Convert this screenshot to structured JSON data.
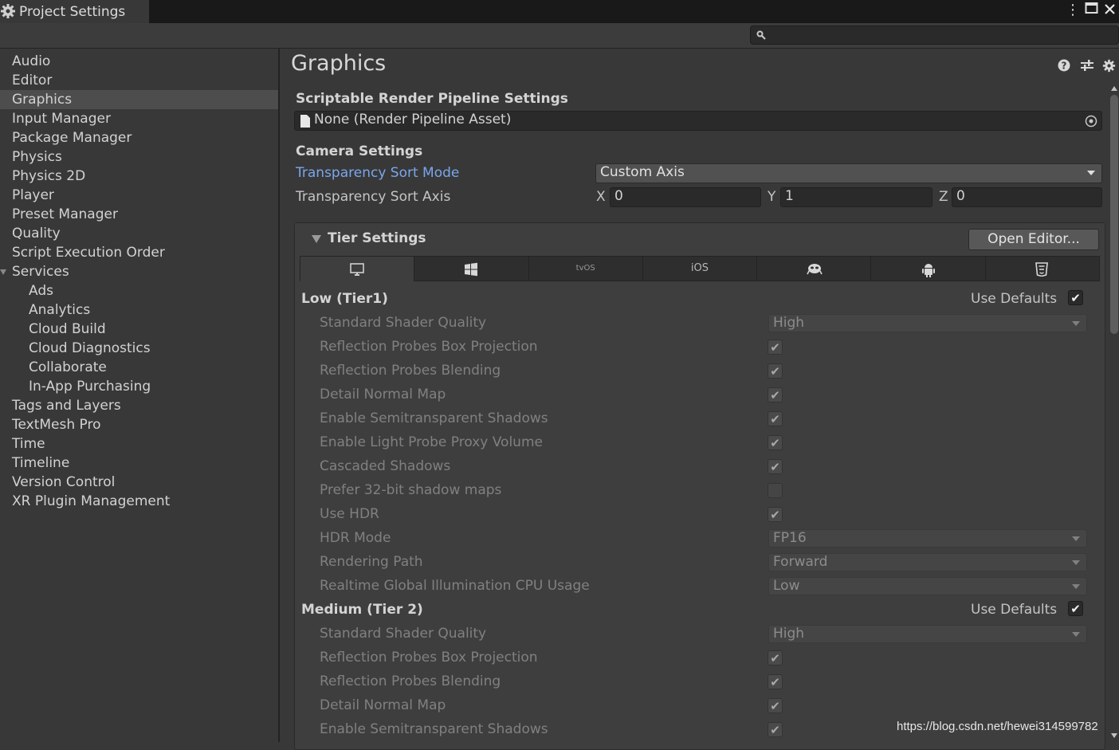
{
  "window": {
    "tab_title": "Project Settings"
  },
  "search": {
    "placeholder": ""
  },
  "sidebar": {
    "items": [
      {
        "label": "Audio",
        "indent": 0
      },
      {
        "label": "Editor",
        "indent": 0
      },
      {
        "label": "Graphics",
        "indent": 0,
        "selected": true
      },
      {
        "label": "Input Manager",
        "indent": 0
      },
      {
        "label": "Package Manager",
        "indent": 0
      },
      {
        "label": "Physics",
        "indent": 0
      },
      {
        "label": "Physics 2D",
        "indent": 0
      },
      {
        "label": "Player",
        "indent": 0
      },
      {
        "label": "Preset Manager",
        "indent": 0
      },
      {
        "label": "Quality",
        "indent": 0
      },
      {
        "label": "Script Execution Order",
        "indent": 0
      },
      {
        "label": "Services",
        "indent": 0,
        "foldout": true
      },
      {
        "label": "Ads",
        "indent": 1
      },
      {
        "label": "Analytics",
        "indent": 1
      },
      {
        "label": "Cloud Build",
        "indent": 1
      },
      {
        "label": "Cloud Diagnostics",
        "indent": 1
      },
      {
        "label": "Collaborate",
        "indent": 1
      },
      {
        "label": "In-App Purchasing",
        "indent": 1
      },
      {
        "label": "Tags and Layers",
        "indent": 0
      },
      {
        "label": "TextMesh Pro",
        "indent": 0
      },
      {
        "label": "Time",
        "indent": 0
      },
      {
        "label": "Timeline",
        "indent": 0
      },
      {
        "label": "Version Control",
        "indent": 0
      },
      {
        "label": "XR Plugin Management",
        "indent": 0
      }
    ]
  },
  "main": {
    "title": "Graphics",
    "srp": {
      "section": "Scriptable Render Pipeline Settings",
      "value": "None (Render Pipeline Asset)"
    },
    "camera": {
      "section": "Camera Settings",
      "sort_mode_label": "Transparency Sort Mode",
      "sort_mode_value": "Custom Axis",
      "sort_axis_label": "Transparency Sort Axis",
      "axis": {
        "x_label": "X",
        "x": "0",
        "y_label": "Y",
        "y": "1",
        "z_label": "Z",
        "z": "0"
      }
    },
    "tier": {
      "section": "Tier Settings",
      "open_editor": "Open Editor...",
      "platform_tabs": [
        {
          "name": "standalone",
          "text": ""
        },
        {
          "name": "windows",
          "text": ""
        },
        {
          "name": "tvos",
          "text": "tvOS"
        },
        {
          "name": "ios",
          "text": "iOS"
        },
        {
          "name": "webgl-alien",
          "text": ""
        },
        {
          "name": "android",
          "text": ""
        },
        {
          "name": "html5",
          "text": ""
        }
      ],
      "use_defaults_label": "Use Defaults",
      "tiers": [
        {
          "title": "Low (Tier1)",
          "use_defaults": true,
          "rows": [
            {
              "label": "Standard Shader Quality",
              "type": "dropdown",
              "value": "High"
            },
            {
              "label": "Reflection Probes Box Projection",
              "type": "check",
              "value": true
            },
            {
              "label": "Reflection Probes Blending",
              "type": "check",
              "value": true
            },
            {
              "label": "Detail Normal Map",
              "type": "check",
              "value": true
            },
            {
              "label": "Enable Semitransparent Shadows",
              "type": "check",
              "value": true
            },
            {
              "label": "Enable Light Probe Proxy Volume",
              "type": "check",
              "value": true
            },
            {
              "label": "Cascaded Shadows",
              "type": "check",
              "value": true
            },
            {
              "label": "Prefer 32-bit shadow maps",
              "type": "check",
              "value": false
            },
            {
              "label": "Use HDR",
              "type": "check",
              "value": true
            },
            {
              "label": "HDR Mode",
              "type": "dropdown",
              "value": "FP16"
            },
            {
              "label": "Rendering Path",
              "type": "dropdown",
              "value": "Forward"
            },
            {
              "label": "Realtime Global Illumination CPU Usage",
              "type": "dropdown",
              "value": "Low"
            }
          ]
        },
        {
          "title": "Medium (Tier 2)",
          "use_defaults": true,
          "rows": [
            {
              "label": "Standard Shader Quality",
              "type": "dropdown",
              "value": "High"
            },
            {
              "label": "Reflection Probes Box Projection",
              "type": "check",
              "value": true
            },
            {
              "label": "Reflection Probes Blending",
              "type": "check",
              "value": true
            },
            {
              "label": "Detail Normal Map",
              "type": "check",
              "value": true
            },
            {
              "label": "Enable Semitransparent Shadows",
              "type": "check",
              "value": true
            }
          ]
        }
      ]
    }
  },
  "watermark": "https://blog.csdn.net/hewei314599782"
}
